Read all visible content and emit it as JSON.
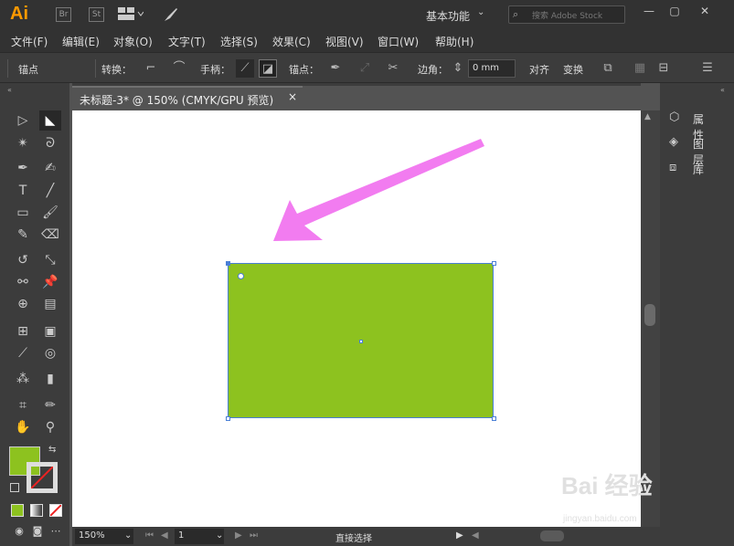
{
  "app": {
    "name": "Ai",
    "bridge": "Br",
    "stock": "St"
  },
  "workspace": {
    "label": "基本功能"
  },
  "search": {
    "placeholder": "搜索 Adobe Stock"
  },
  "menu": [
    "文件(F)",
    "编辑(E)",
    "对象(O)",
    "文字(T)",
    "选择(S)",
    "效果(C)",
    "视图(V)",
    "窗口(W)",
    "帮助(H)"
  ],
  "control": {
    "anchor": "锚点",
    "convert": "转换：",
    "handles": "手柄：",
    "anchors": "锚点：",
    "corner": "边角：",
    "corner_value": "0 mm",
    "align": "对齐",
    "transform": "变换"
  },
  "document": {
    "tab_title": "未标题-3* @ 150% (CMYK/GPU 预览)",
    "close": "×"
  },
  "artwork": {
    "rect_color": "#8DC21F",
    "arrow_color": "#F27CF0",
    "artboard_color": "#FFFFFF"
  },
  "panels": [
    {
      "icon": "properties-icon",
      "label": "属性"
    },
    {
      "icon": "layers-icon",
      "label": "图层"
    },
    {
      "icon": "libraries-icon",
      "label": "库"
    }
  ],
  "status": {
    "zoom": "150%",
    "page": "1",
    "tool": "直接选择"
  },
  "watermark": {
    "text": "Bai 经验",
    "url": "jingyan.baidu.com"
  }
}
